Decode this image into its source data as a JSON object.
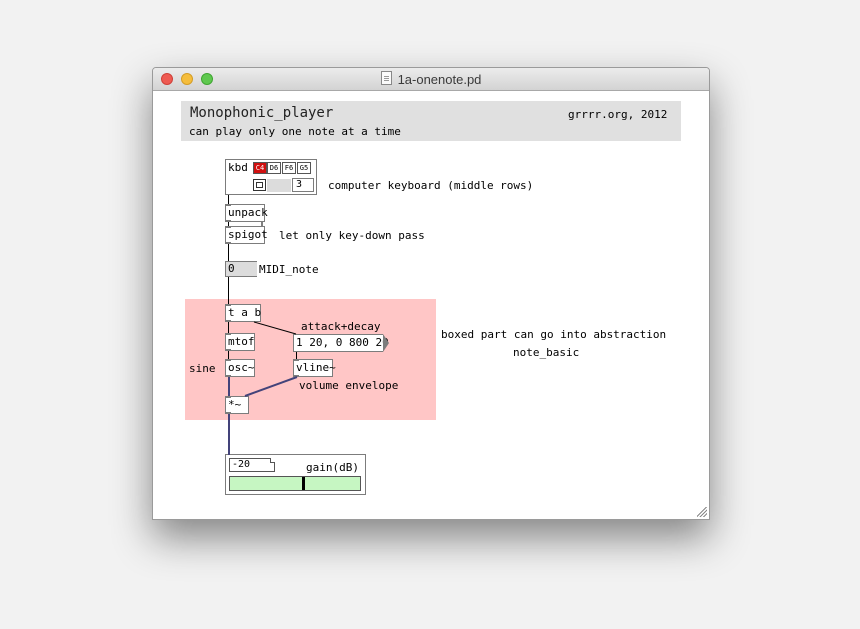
{
  "window": {
    "title": "1a-onenote.pd"
  },
  "header": {
    "title": "Monophonic_player",
    "credit": "grrrr.org, 2012",
    "subtitle": "can play only one note at a time"
  },
  "kbd": {
    "label": "kbd",
    "keys": [
      {
        "label": "C4",
        "pressed": true
      },
      {
        "label": "D6",
        "pressed": false
      },
      {
        "label": "F6",
        "pressed": false
      },
      {
        "label": "G5",
        "pressed": false
      }
    ],
    "number": "3",
    "comment": "computer keyboard (middle rows)"
  },
  "objects": {
    "unpack": "unpack",
    "spigot": "spigot",
    "spigot_comment": "let only key-down pass",
    "midi_number": "0",
    "midi_comment": "MIDI_note",
    "tab": "t a b",
    "attack_comment": "attack+decay",
    "envelope_msg": "1 20, 0 800 20",
    "mtof": "mtof",
    "osc": "osc~",
    "vline": "vline~",
    "sine_comment": "sine",
    "volume_comment": "volume envelope",
    "mult": "*~",
    "abstraction_comment_1": "boxed part can go into abstraction",
    "abstraction_comment_2": "note_basic"
  },
  "gain": {
    "value": "-20",
    "label": "gain(dB)",
    "slider_level": 0.57
  },
  "colors": {
    "boxed_area": "#ffc6c6",
    "header_bg": "#e0e0e0",
    "signal_wire": "#43437a",
    "slider_fill": "#c6f6c2",
    "key_pressed": "#d01010"
  }
}
